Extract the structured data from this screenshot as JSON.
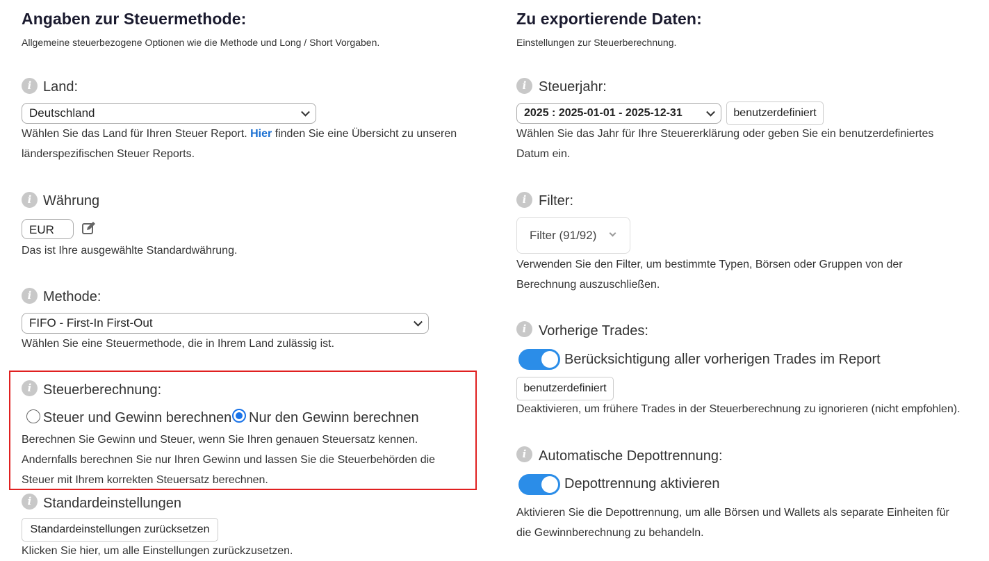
{
  "left": {
    "title": "Angaben zur Steuermethode:",
    "subtitle": "Allgemeine steuerbezogene Optionen wie die Methode und Long / Short Vorgaben.",
    "land": {
      "label": "Land:",
      "value": "Deutschland",
      "desc_before": "Wählen Sie das Land für Ihren Steuer Report. ",
      "link": "Hier",
      "desc_after": " finden Sie eine Übersicht zu unseren",
      "desc_line2": "länderspezifischen Steuer Reports."
    },
    "waehrung": {
      "label": "Währung",
      "value": "EUR",
      "desc": "Das ist Ihre ausgewählte Standardwährung."
    },
    "methode": {
      "label": "Methode:",
      "value": "FIFO - First-In First-Out",
      "desc": "Wählen Sie eine Steuermethode, die in Ihrem Land zulässig ist."
    },
    "steuerberechnung": {
      "label": "Steuerberechnung:",
      "option1": "Steuer und Gewinn berechnen",
      "option2": "Nur den Gewinn berechnen",
      "selected": "option2",
      "desc1": "Berechnen Sie Gewinn und Steuer, wenn Sie Ihren genauen Steuersatz kennen.",
      "desc2": "Andernfalls berechnen Sie nur Ihren Gewinn und lassen Sie die Steuerbehörden die",
      "desc3": "Steuer mit Ihrem korrekten Steuersatz berechnen."
    },
    "standard": {
      "label": "Standardeinstellungen",
      "button": "Standardeinstellungen zurücksetzen",
      "desc": "Klicken Sie hier, um alle Einstellungen zurückzusetzen."
    }
  },
  "right": {
    "title": "Zu exportierende Daten:",
    "subtitle": "Einstellungen zur Steuerberechnung.",
    "steuerjahr": {
      "label": "Steuerjahr:",
      "value": "2025 : 2025-01-01 - 2025-12-31",
      "button": "benutzerdefiniert",
      "desc1": "Wählen Sie das Jahr für Ihre Steuererklärung oder geben Sie ein benutzerdefiniertes",
      "desc2": "Datum ein."
    },
    "filter": {
      "label": "Filter:",
      "button": "Filter (91/92)",
      "desc1": "Verwenden Sie den Filter, um bestimmte Typen, Börsen oder Gruppen von der",
      "desc2": "Berechnung auszuschließen."
    },
    "vorherige": {
      "label": "Vorherige Trades:",
      "toggle_label": "Berücksichtigung aller vorherigen Trades im Report",
      "toggle_on": true,
      "button": "benutzerdefiniert",
      "desc": "Deaktivieren, um frühere Trades in der Steuerberechnung zu ignorieren (nicht empfohlen)."
    },
    "depot": {
      "label": "Automatische Depottrennung:",
      "toggle_label": "Depottrennung aktivieren",
      "toggle_on": true,
      "desc1": "Aktivieren Sie die Depottrennung, um alle Börsen und Wallets als separate Einheiten für",
      "desc2": "die Gewinnberechnung zu behandeln."
    }
  },
  "colors": {
    "accent": "#2b8de8",
    "highlight_border": "#e02020",
    "link": "#1a6fd1"
  }
}
